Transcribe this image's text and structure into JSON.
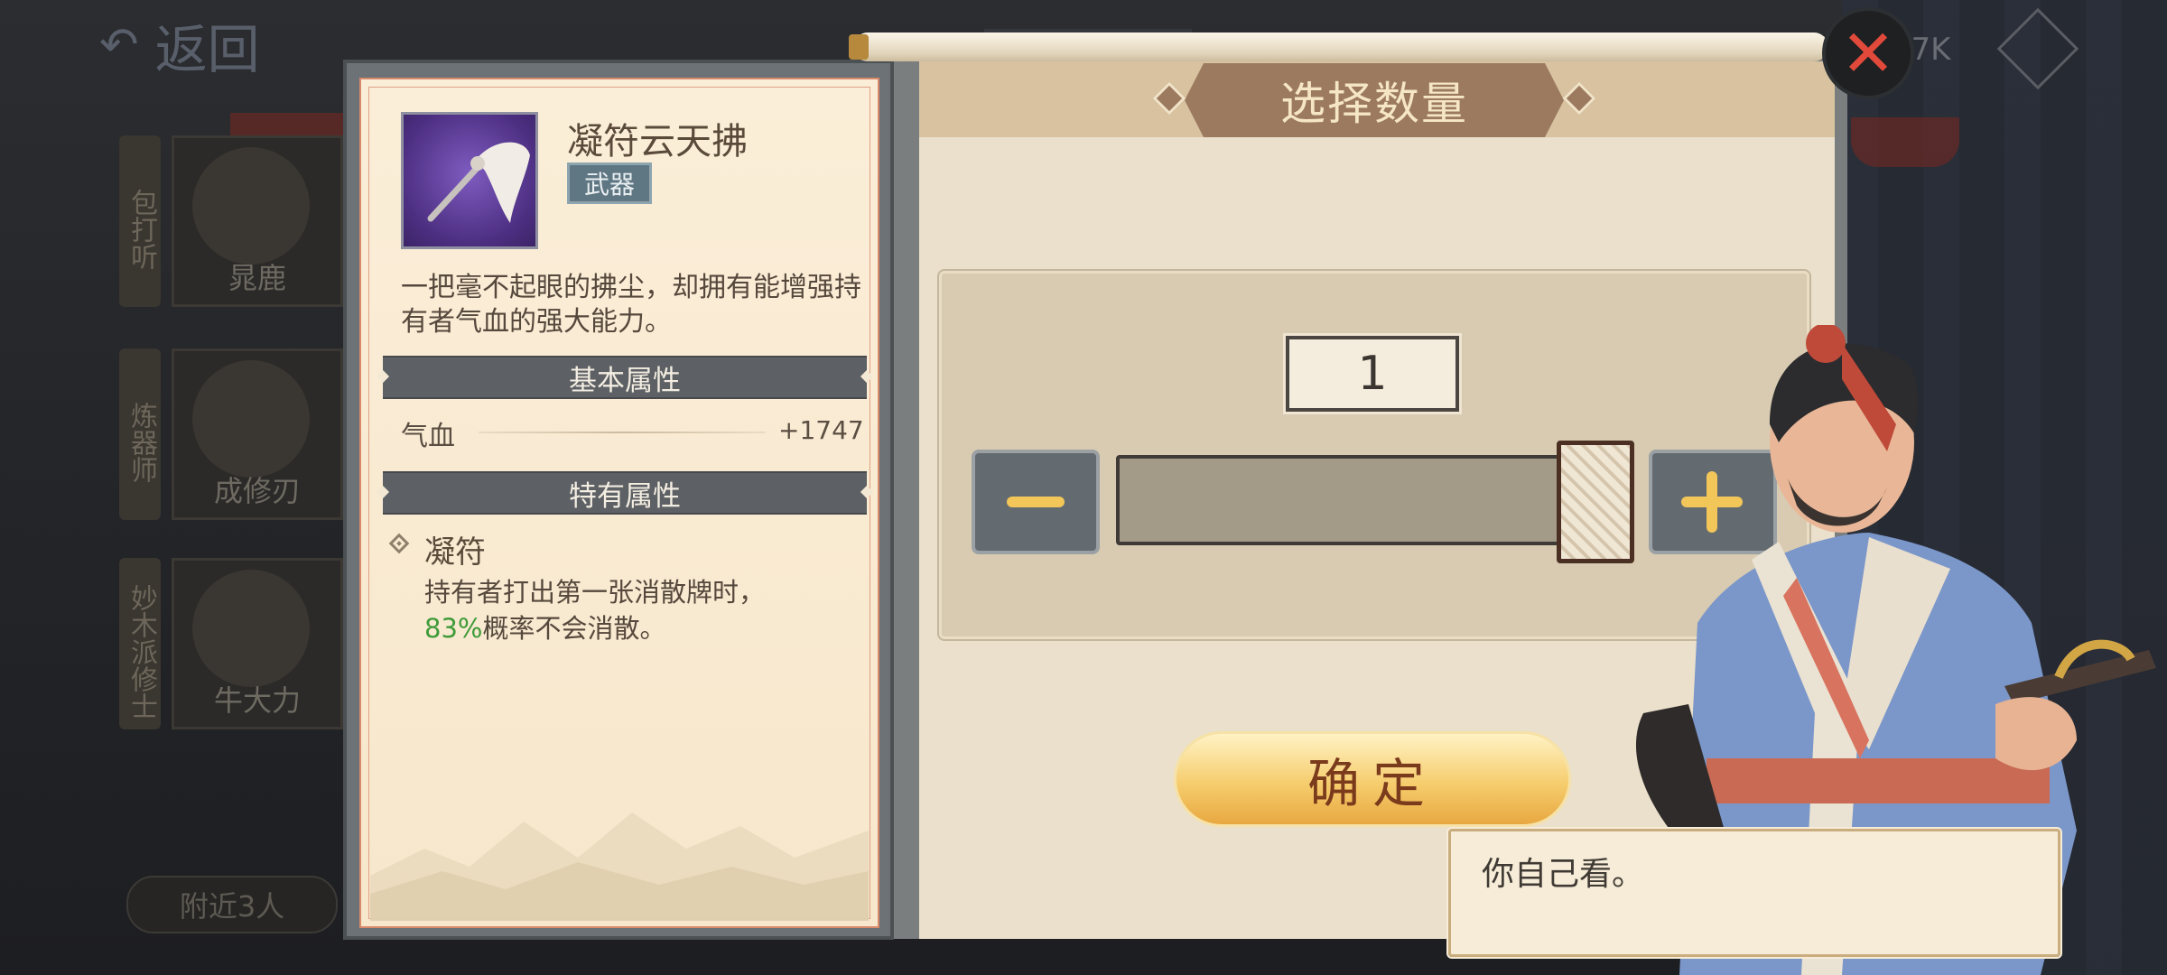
{
  "background": {
    "back_label": "返回",
    "currency_amount": "2.7K",
    "npc_list": [
      {
        "tab": "包打听",
        "name": "晁鹿"
      },
      {
        "tab": "炼器师",
        "name": "成修刃"
      },
      {
        "tab": "妙木派修士",
        "name": "牛大力"
      }
    ],
    "nearby_label": "附近3人"
  },
  "item": {
    "name": "凝符云天拂",
    "tag": "武器",
    "description": "一把毫不起眼的拂尘，却拥有能增强持有者气血的强大能力。",
    "basic_attributes_title": "基本属性",
    "stat_label": "气血",
    "stat_value": "+1747",
    "unique_attributes_title": "特有属性",
    "unique_name": "凝符",
    "unique_desc_line1": "持有者打出第一张消散牌时，",
    "unique_percent": "83%",
    "unique_desc_line2": "概率不会消散。"
  },
  "quantity": {
    "title": "选择数量",
    "value": "1",
    "minus_icon": "minus-icon",
    "plus_icon": "plus-icon",
    "slider_level": 1.0,
    "confirm_label": "确定"
  },
  "dialog": {
    "text": "你自己看。"
  },
  "colors": {
    "accent_gold": "#f2c659",
    "close_red": "#e14a3b",
    "percent_green": "#3f9b3a"
  }
}
